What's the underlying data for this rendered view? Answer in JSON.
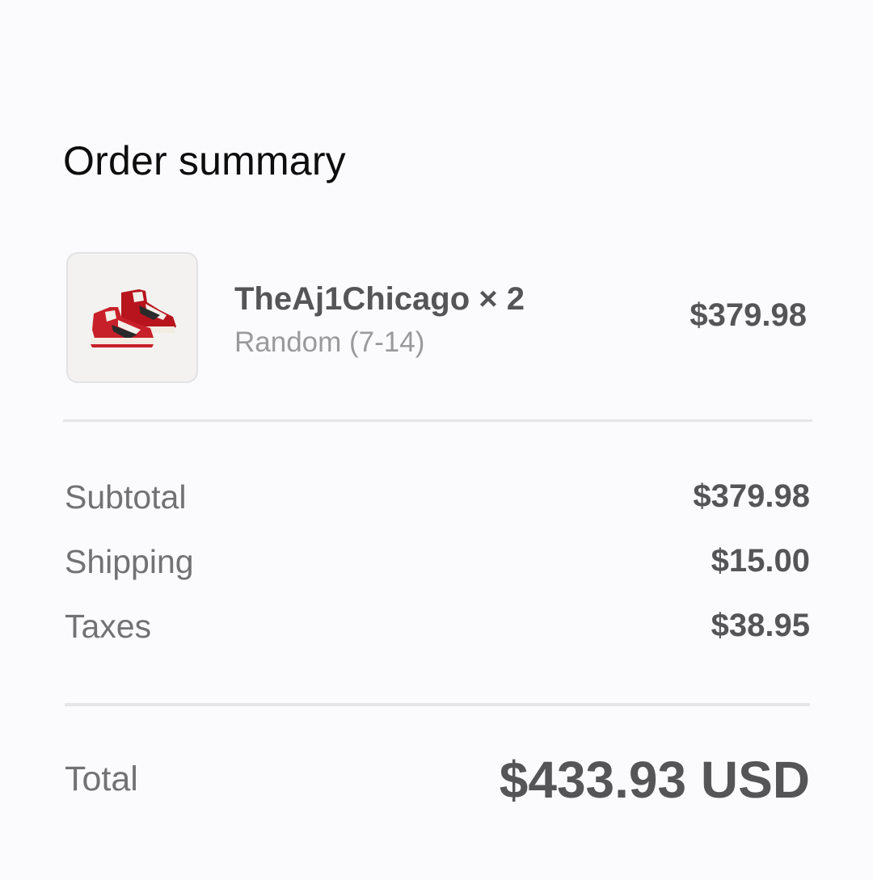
{
  "summary": {
    "title": "Order summary"
  },
  "line_item": {
    "image_icon": "sneaker-product-image",
    "name": "TheAj1Chicago × 2",
    "variant": "Random (7-14)",
    "price": "$379.98"
  },
  "totals": {
    "rows": [
      {
        "label": "Subtotal",
        "value": "$379.98"
      },
      {
        "label": "Shipping",
        "value": "$15.00"
      },
      {
        "label": "Taxes",
        "value": "$38.95"
      }
    ],
    "total_label": "Total",
    "total_value": "$433.93 USD"
  },
  "colors": {
    "background": "#fbfbfd",
    "text_primary": "#0d0d0d",
    "text_strong": "#555557",
    "text_muted": "#727274",
    "text_light": "#9a9a9c",
    "divider": "#e6e6e8",
    "shoe_red": "#c8202a"
  }
}
